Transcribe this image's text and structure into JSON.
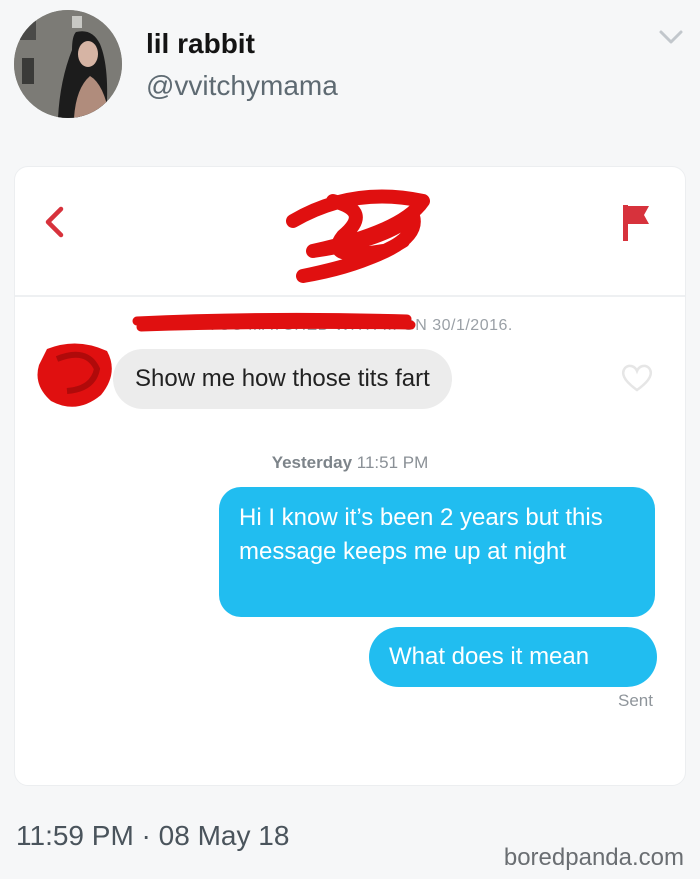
{
  "author": {
    "display_name": "lil rabbit",
    "handle": "@vvitchymama"
  },
  "conversation": {
    "match_info": "YOU MATCHED WITH ... ON 30/1/2016.",
    "incoming_message": "Show me how those tits fart",
    "timestamp_day": "Yesterday",
    "timestamp_time": "11:51 PM",
    "outgoing_messages": [
      "Hi I know it’s been 2 years but this message keeps me up at night",
      "What does it mean"
    ],
    "status": "Sent"
  },
  "tweet_meta": "11:59 PM · 08 May 18",
  "watermark": "boredpanda.com",
  "colors": {
    "accent_red": "#d7323c",
    "outgoing_bubble": "#21bdf0",
    "incoming_bubble": "#ececec",
    "scribble": "#e01010"
  }
}
